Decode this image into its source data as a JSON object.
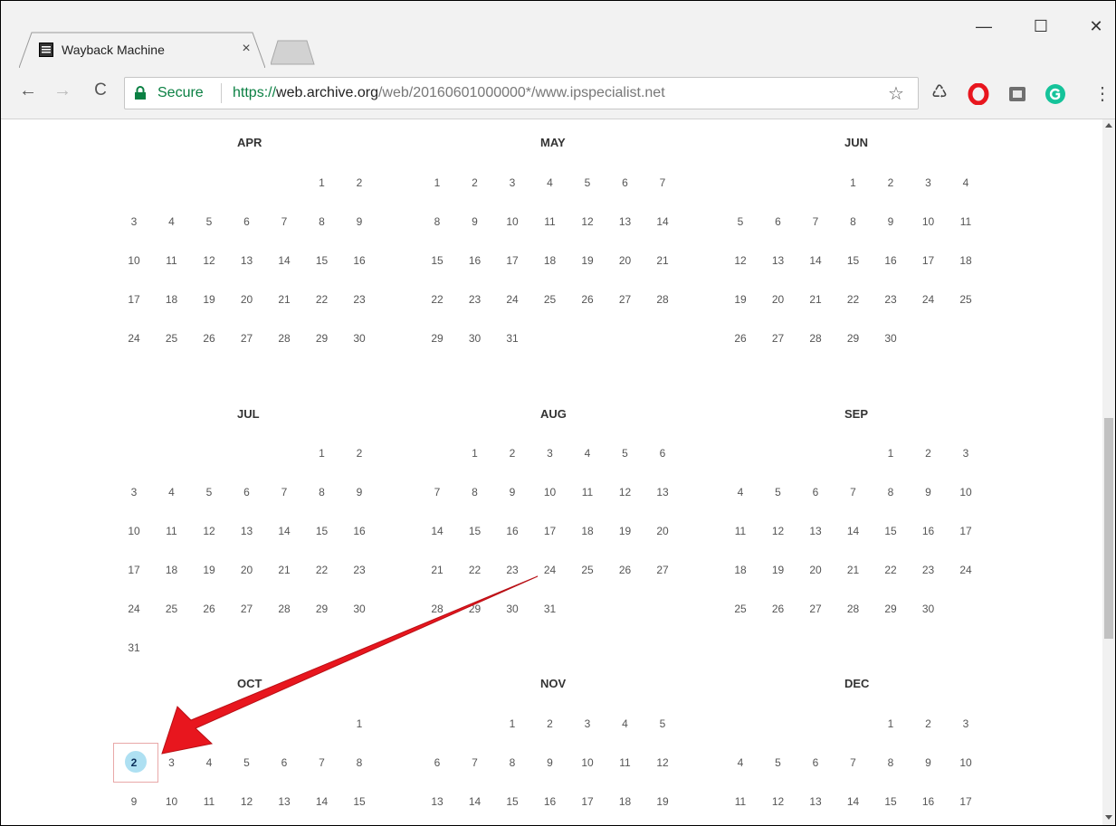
{
  "browser": {
    "tab_title": "Wayback Machine",
    "tab_close": "×",
    "window_minimize": "—",
    "window_maximize": "☐",
    "window_close": "✕",
    "nav_back": "←",
    "nav_forward": "→",
    "nav_reload": "C",
    "secure_label": "Secure",
    "url_scheme": "https://",
    "url_host": "web.archive.org",
    "url_path": "/web/20160601000000*/www.ipspecialist.net",
    "bookmark_star": "☆",
    "recycle_icon": "♺",
    "menu": "⋮",
    "colors": {
      "secure_green": "#0b8043",
      "opera_red": "#e8161e",
      "grammarly_green": "#15c39a",
      "highlight_blue": "#aee0f2",
      "annotation_red": "#e8161e"
    },
    "icons": [
      "page-favicon",
      "lock-icon",
      "star-icon",
      "recycle-extension-icon",
      "opera-icon",
      "box-extension-icon",
      "grammarly-icon",
      "menu-icon"
    ]
  },
  "calendar": {
    "months": [
      {
        "name": "APR",
        "weeks": [
          [
            "",
            "",
            "",
            "",
            "",
            "1",
            "2"
          ],
          [
            "3",
            "4",
            "5",
            "6",
            "7",
            "8",
            "9"
          ],
          [
            "10",
            "11",
            "12",
            "13",
            "14",
            "15",
            "16"
          ],
          [
            "17",
            "18",
            "19",
            "20",
            "21",
            "22",
            "23"
          ],
          [
            "24",
            "25",
            "26",
            "27",
            "28",
            "29",
            "30"
          ]
        ]
      },
      {
        "name": "MAY",
        "weeks": [
          [
            "1",
            "2",
            "3",
            "4",
            "5",
            "6",
            "7"
          ],
          [
            "8",
            "9",
            "10",
            "11",
            "12",
            "13",
            "14"
          ],
          [
            "15",
            "16",
            "17",
            "18",
            "19",
            "20",
            "21"
          ],
          [
            "22",
            "23",
            "24",
            "25",
            "26",
            "27",
            "28"
          ],
          [
            "29",
            "30",
            "31",
            "",
            "",
            "",
            ""
          ]
        ]
      },
      {
        "name": "JUN",
        "weeks": [
          [
            "",
            "",
            "",
            "1",
            "2",
            "3",
            "4"
          ],
          [
            "5",
            "6",
            "7",
            "8",
            "9",
            "10",
            "11"
          ],
          [
            "12",
            "13",
            "14",
            "15",
            "16",
            "17",
            "18"
          ],
          [
            "19",
            "20",
            "21",
            "22",
            "23",
            "24",
            "25"
          ],
          [
            "26",
            "27",
            "28",
            "29",
            "30",
            "",
            ""
          ]
        ]
      },
      {
        "name": "JUL",
        "weeks": [
          [
            "",
            "",
            "",
            "",
            "",
            "1",
            "2"
          ],
          [
            "3",
            "4",
            "5",
            "6",
            "7",
            "8",
            "9"
          ],
          [
            "10",
            "11",
            "12",
            "13",
            "14",
            "15",
            "16"
          ],
          [
            "17",
            "18",
            "19",
            "20",
            "21",
            "22",
            "23"
          ],
          [
            "24",
            "25",
            "26",
            "27",
            "28",
            "29",
            "30"
          ],
          [
            "31",
            "",
            "",
            "",
            "",
            "",
            ""
          ]
        ]
      },
      {
        "name": "AUG",
        "weeks": [
          [
            "",
            "1",
            "2",
            "3",
            "4",
            "5",
            "6"
          ],
          [
            "7",
            "8",
            "9",
            "10",
            "11",
            "12",
            "13"
          ],
          [
            "14",
            "15",
            "16",
            "17",
            "18",
            "19",
            "20"
          ],
          [
            "21",
            "22",
            "23",
            "24",
            "25",
            "26",
            "27"
          ],
          [
            "28",
            "29",
            "30",
            "31",
            "",
            "",
            ""
          ]
        ]
      },
      {
        "name": "SEP",
        "weeks": [
          [
            "",
            "",
            "",
            "",
            "1",
            "2",
            "3"
          ],
          [
            "4",
            "5",
            "6",
            "7",
            "8",
            "9",
            "10"
          ],
          [
            "11",
            "12",
            "13",
            "14",
            "15",
            "16",
            "17"
          ],
          [
            "18",
            "19",
            "20",
            "21",
            "22",
            "23",
            "24"
          ],
          [
            "25",
            "26",
            "27",
            "28",
            "29",
            "30",
            ""
          ]
        ]
      },
      {
        "name": "OCT",
        "weeks": [
          [
            "",
            "",
            "",
            "",
            "",
            "",
            "1"
          ],
          [
            "2",
            "3",
            "4",
            "5",
            "6",
            "7",
            "8"
          ],
          [
            "9",
            "10",
            "11",
            "12",
            "13",
            "14",
            "15"
          ]
        ]
      },
      {
        "name": "NOV",
        "weeks": [
          [
            "",
            "",
            "1",
            "2",
            "3",
            "4",
            "5"
          ],
          [
            "6",
            "7",
            "8",
            "9",
            "10",
            "11",
            "12"
          ],
          [
            "13",
            "14",
            "15",
            "16",
            "17",
            "18",
            "19"
          ]
        ]
      },
      {
        "name": "DEC",
        "weeks": [
          [
            "",
            "",
            "",
            "",
            "1",
            "2",
            "3"
          ],
          [
            "4",
            "5",
            "6",
            "7",
            "8",
            "9",
            "10"
          ],
          [
            "11",
            "12",
            "13",
            "14",
            "15",
            "16",
            "17"
          ]
        ]
      }
    ],
    "highlighted": {
      "month": "OCT",
      "day": "2"
    }
  }
}
